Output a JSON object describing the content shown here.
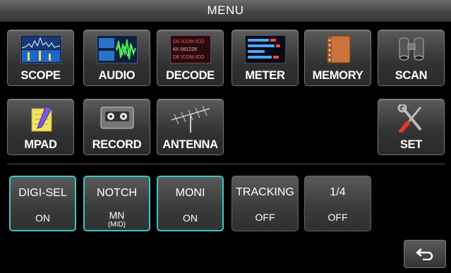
{
  "header": {
    "title": "MENU"
  },
  "menu": {
    "scope": "SCOPE",
    "audio": "AUDIO",
    "decode": "DECODE",
    "meter": "METER",
    "memory": "MEMORY",
    "scan": "SCAN",
    "mpad": "MPAD",
    "record": "RECORD",
    "antenna": "ANTENNA",
    "set": "SET"
  },
  "decode_icon_text": [
    "DE ICOM ICO",
    "6X 081228",
    "DE ICOM ICO"
  ],
  "functions": [
    {
      "title": "DIGI-SEL",
      "state": "ON",
      "sub": "",
      "active": true
    },
    {
      "title": "NOTCH",
      "state": "MN",
      "sub": "(MID)",
      "active": true
    },
    {
      "title": "MONI",
      "state": "ON",
      "sub": "",
      "active": true
    },
    {
      "title": "TRACKING",
      "state": "OFF",
      "sub": "",
      "active": false
    },
    {
      "title": "1/4",
      "state": "OFF",
      "sub": "",
      "active": false
    }
  ],
  "icons": {
    "scope": "scope-icon",
    "audio": "audio-icon",
    "decode": "decode-icon",
    "meter": "meter-icon",
    "memory": "memory-icon",
    "scan": "binoculars-icon",
    "mpad": "notepad-icon",
    "record": "cassette-icon",
    "antenna": "antenna-icon",
    "set": "tools-icon",
    "return": "return-icon"
  },
  "colors": {
    "active_border": "#3ec6c6",
    "background": "#000000"
  }
}
